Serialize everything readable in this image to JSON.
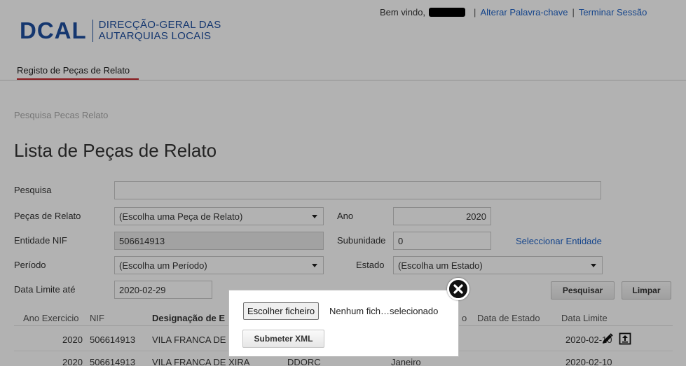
{
  "header": {
    "logo_mark": "DCAL",
    "logo_line1": "DIRECÇÃO-GERAL DAS",
    "logo_line2": "AUTARQUIAS LOCAIS",
    "welcome": "Bem vindo,",
    "change_password": "Alterar Palavra-chave",
    "logout": "Terminar Sessão",
    "brand_color": "#1f4fa0"
  },
  "nav": {
    "active_tab": "Registo de Peças de Relato",
    "accent": "#c5262b"
  },
  "breadcrumb": "Pesquisa Pecas Relato",
  "page_title": "Lista de Peças de Relato",
  "form": {
    "search_label": "Pesquisa",
    "search_value": "",
    "pecas_label": "Peças de Relato",
    "pecas_value": "(Escolha uma Peça de Relato)",
    "ano_label": "Ano",
    "ano_value": "2020",
    "nif_label": "Entidade NIF",
    "nif_value": "506614913",
    "subunidade_label": "Subunidade",
    "subunidade_value": "0",
    "select_entity": "Seleccionar Entidade",
    "periodo_label": "Período",
    "periodo_value": "(Escolha um Período)",
    "estado_label": "Estado",
    "estado_value": "(Escolha um Estado)",
    "data_limite_label": "Data Limite até",
    "data_limite_value": "2020-02-29",
    "search_button": "Pesquisar",
    "clear_button": "Limpar"
  },
  "table": {
    "headers": [
      "Ano Exercicio",
      "NIF",
      "Designação de E",
      "o",
      "Data de Estado",
      "Data Limite"
    ],
    "rows": [
      {
        "ano": "2020",
        "nif": "506614913",
        "designacao": "VILA FRANCA DE",
        "orgao": "",
        "periodo": "",
        "data_limite": "2020-02-10"
      },
      {
        "ano": "2020",
        "nif": "506614913",
        "designacao": "VILA FRANCA DE XIRA",
        "orgao": "DDORC",
        "periodo": "Janeiro",
        "data_limite": "2020-02-10"
      }
    ]
  },
  "dialog": {
    "choose_file": "Escolher ficheiro",
    "file_status": "Nenhum fich…selecionado",
    "submit": "Submeter XML"
  }
}
